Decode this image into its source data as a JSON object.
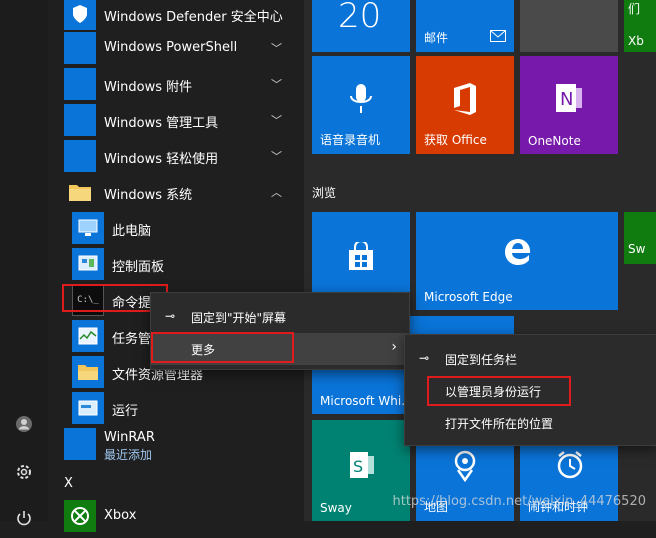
{
  "app_list": {
    "folders": [
      {
        "label": "Windows Defender 安全中心"
      },
      {
        "label": "Windows PowerShell"
      },
      {
        "label": "Windows 附件"
      },
      {
        "label": "Windows 管理工具"
      },
      {
        "label": "Windows 轻松使用"
      },
      {
        "label": "Windows 系统"
      }
    ],
    "system_items": [
      {
        "label": "此电脑"
      },
      {
        "label": "控制面板"
      },
      {
        "label": "命令提示符"
      },
      {
        "label": "任务管理器"
      },
      {
        "label": "文件资源管理器"
      },
      {
        "label": "运行"
      }
    ],
    "winrar": {
      "label": "WinRAR",
      "sub": "最近添加"
    },
    "letter_x": "X",
    "xbox": {
      "label": "Xbox"
    }
  },
  "tiles": {
    "calendar_number": "20",
    "mail": "邮件",
    "voice": "语音录音机",
    "office": "获取 Office",
    "onenote": "OneNote",
    "section_browse": "浏览",
    "store": "",
    "edge": "Microsoft Edge",
    "whiteboard": "Microsoft Whi...",
    "sway": "Sway",
    "maps": "地图",
    "alarms": "闹钟和时钟",
    "right_top": "们",
    "right_xb": "Xb",
    "right_sw": "Sw"
  },
  "context_menu": {
    "pin_start": "固定到\"开始\"屏幕",
    "more": "更多"
  },
  "submenu": {
    "pin_taskbar": "固定到任务栏",
    "run_admin": "以管理员身份运行",
    "open_location": "打开文件所在的位置"
  },
  "watermark": "https://blog.csdn.net/weixin_44476520",
  "colors": {
    "accent": "#0a74d8",
    "highlight_border": "#e01b1b",
    "office": "#d83b01",
    "onenote": "#7719aa",
    "sway": "#008272"
  }
}
